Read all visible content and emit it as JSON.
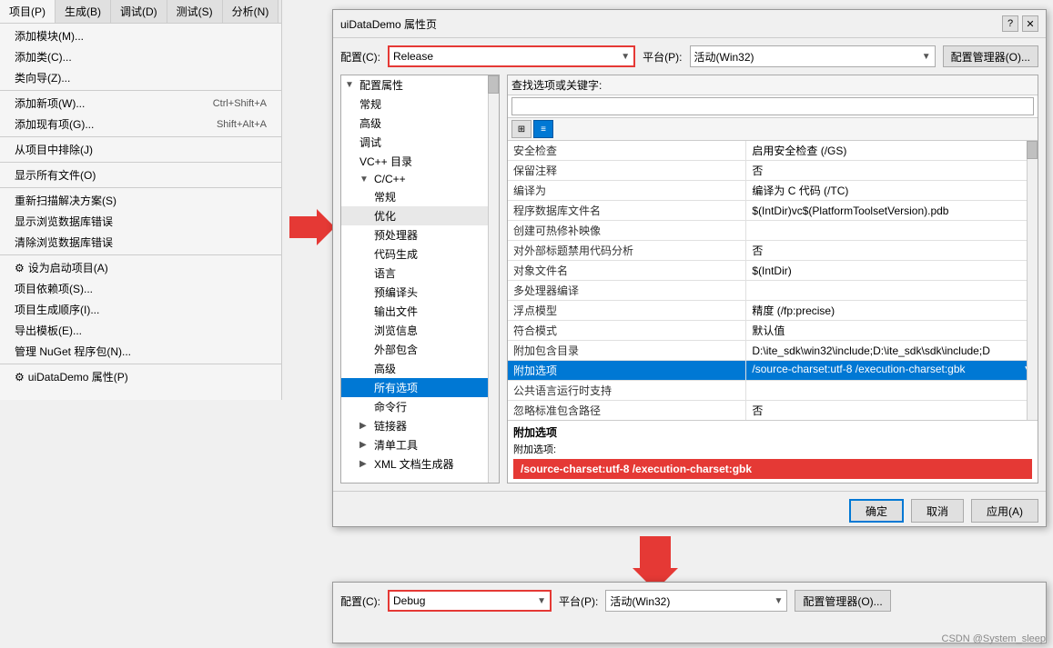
{
  "sidebar": {
    "tabs": [
      "项目(P)",
      "生成(B)",
      "调试(D)",
      "测试(S)",
      "分析(N)"
    ],
    "menu_items": [
      {
        "label": "添加模块(M)...",
        "shortcut": "",
        "icon": false,
        "disabled": false
      },
      {
        "label": "添加类(C)...",
        "shortcut": "",
        "icon": false,
        "disabled": false
      },
      {
        "label": "类向导(Z)...",
        "shortcut": "",
        "icon": false,
        "disabled": false
      },
      {
        "separator": true
      },
      {
        "label": "添加新项(W)...",
        "shortcut": "Ctrl+Shift+A",
        "icon": false,
        "disabled": false
      },
      {
        "label": "添加现有项(G)...",
        "shortcut": "Shift+Alt+A",
        "icon": false,
        "disabled": false
      },
      {
        "separator": true
      },
      {
        "label": "从项目中排除(J)",
        "shortcut": "",
        "icon": false,
        "disabled": false
      },
      {
        "separator": true
      },
      {
        "label": "显示所有文件(O)",
        "shortcut": "",
        "icon": false,
        "disabled": false
      },
      {
        "separator": true
      },
      {
        "label": "重新扫描解决方案(S)",
        "shortcut": "",
        "icon": false,
        "disabled": false
      },
      {
        "label": "显示浏览数据库错误",
        "shortcut": "",
        "icon": false,
        "disabled": false
      },
      {
        "label": "清除浏览数据库错误",
        "shortcut": "",
        "icon": false,
        "disabled": false
      },
      {
        "separator": true
      },
      {
        "label": "设为启动项目(A)",
        "shortcut": "",
        "icon": "gear",
        "disabled": false
      },
      {
        "label": "项目依赖项(S)...",
        "shortcut": "",
        "icon": false,
        "disabled": false
      },
      {
        "label": "项目生成顺序(I)...",
        "shortcut": "",
        "icon": false,
        "disabled": false
      },
      {
        "label": "导出模板(E)...",
        "shortcut": "",
        "icon": false,
        "disabled": false
      },
      {
        "label": "管理 NuGet 程序包(N)...",
        "shortcut": "",
        "icon": false,
        "disabled": false
      },
      {
        "separator": true
      },
      {
        "label": "uiDataDemo 属性(P)",
        "shortcut": "",
        "icon": "gear",
        "disabled": false
      }
    ]
  },
  "dialog_top": {
    "title": "uiDataDemo 属性页",
    "config_label": "配置(C):",
    "config_value": "Release",
    "platform_label": "平台(P):",
    "platform_value": "活动(Win32)",
    "config_mgr_label": "配置管理器(O)...",
    "search_placeholder": "查找选项或关键字:",
    "tree": {
      "items": [
        {
          "label": "配置属性",
          "level": 0,
          "expanded": true,
          "hasArrow": true
        },
        {
          "label": "常规",
          "level": 1
        },
        {
          "label": "高级",
          "level": 1
        },
        {
          "label": "调试",
          "level": 1
        },
        {
          "label": "VC++ 目录",
          "level": 1
        },
        {
          "label": "C/C++",
          "level": 1,
          "expanded": true,
          "hasArrow": true
        },
        {
          "label": "常规",
          "level": 2
        },
        {
          "label": "优化",
          "level": 2
        },
        {
          "label": "预处理器",
          "level": 2
        },
        {
          "label": "代码生成",
          "level": 2
        },
        {
          "label": "语言",
          "level": 2
        },
        {
          "label": "预编译头",
          "level": 2
        },
        {
          "label": "输出文件",
          "level": 2
        },
        {
          "label": "浏览信息",
          "level": 2
        },
        {
          "label": "外部包含",
          "level": 2
        },
        {
          "label": "高级",
          "level": 2
        },
        {
          "label": "所有选项",
          "level": 2,
          "selected": true
        },
        {
          "label": "命令行",
          "level": 2
        },
        {
          "label": "链接器",
          "level": 1,
          "hasArrow": true
        },
        {
          "label": "清单工具",
          "level": 1,
          "hasArrow": true
        },
        {
          "label": "XML 文档生成器",
          "level": 1,
          "hasArrow": true
        }
      ]
    },
    "props": {
      "search_placeholder": "",
      "rows": [
        {
          "name": "安全检查",
          "value": "启用安全检查 (/GS)"
        },
        {
          "name": "保留注释",
          "value": "否"
        },
        {
          "name": "编译为",
          "value": "编译为 C 代码 (/TC)"
        },
        {
          "name": "程序数据库文件名",
          "value": "$(IntDir)vc$(PlatformToolsetVersion).pdb"
        },
        {
          "name": "创建可热修补映像",
          "value": ""
        },
        {
          "name": "对外部标题禁用代码分析",
          "value": "否"
        },
        {
          "name": "对象文件名",
          "value": "$(IntDir)"
        },
        {
          "name": "多处理器编译",
          "value": ""
        },
        {
          "name": "浮点模型",
          "value": "精度 (/fp:precise)"
        },
        {
          "name": "符合模式",
          "value": "默认值"
        },
        {
          "name": "附加包含目录",
          "value": "D:\\ite_sdk\\win32\\include;D:\\ite_sdk\\sdk\\include;D"
        },
        {
          "name": "附加选项",
          "value": "/source-charset:utf-8 /execution-charset:gbk",
          "selected": true
        },
        {
          "name": "公共语言运行时支持",
          "value": ""
        },
        {
          "name": "忽略标准包含路径",
          "value": "否"
        }
      ],
      "bottom_title": "附加选项",
      "bottom_subtitle": "附加选项:",
      "bottom_value": "/source-charset:utf-8 /execution-charset:gbk"
    },
    "footer": {
      "ok_label": "确定",
      "cancel_label": "取消",
      "apply_label": "应用(A)"
    }
  },
  "dialog_bottom": {
    "config_label": "配置(C):",
    "config_value": "Debug",
    "platform_label": "平台(P):",
    "platform_value": "活动(Win32)",
    "config_mgr_label": "配置管理器(O)..."
  },
  "watermark": "CSDN @System_sleep",
  "colors": {
    "red_border": "#e53935",
    "blue_selected": "#0078d4",
    "red_highlight": "#e53935"
  }
}
